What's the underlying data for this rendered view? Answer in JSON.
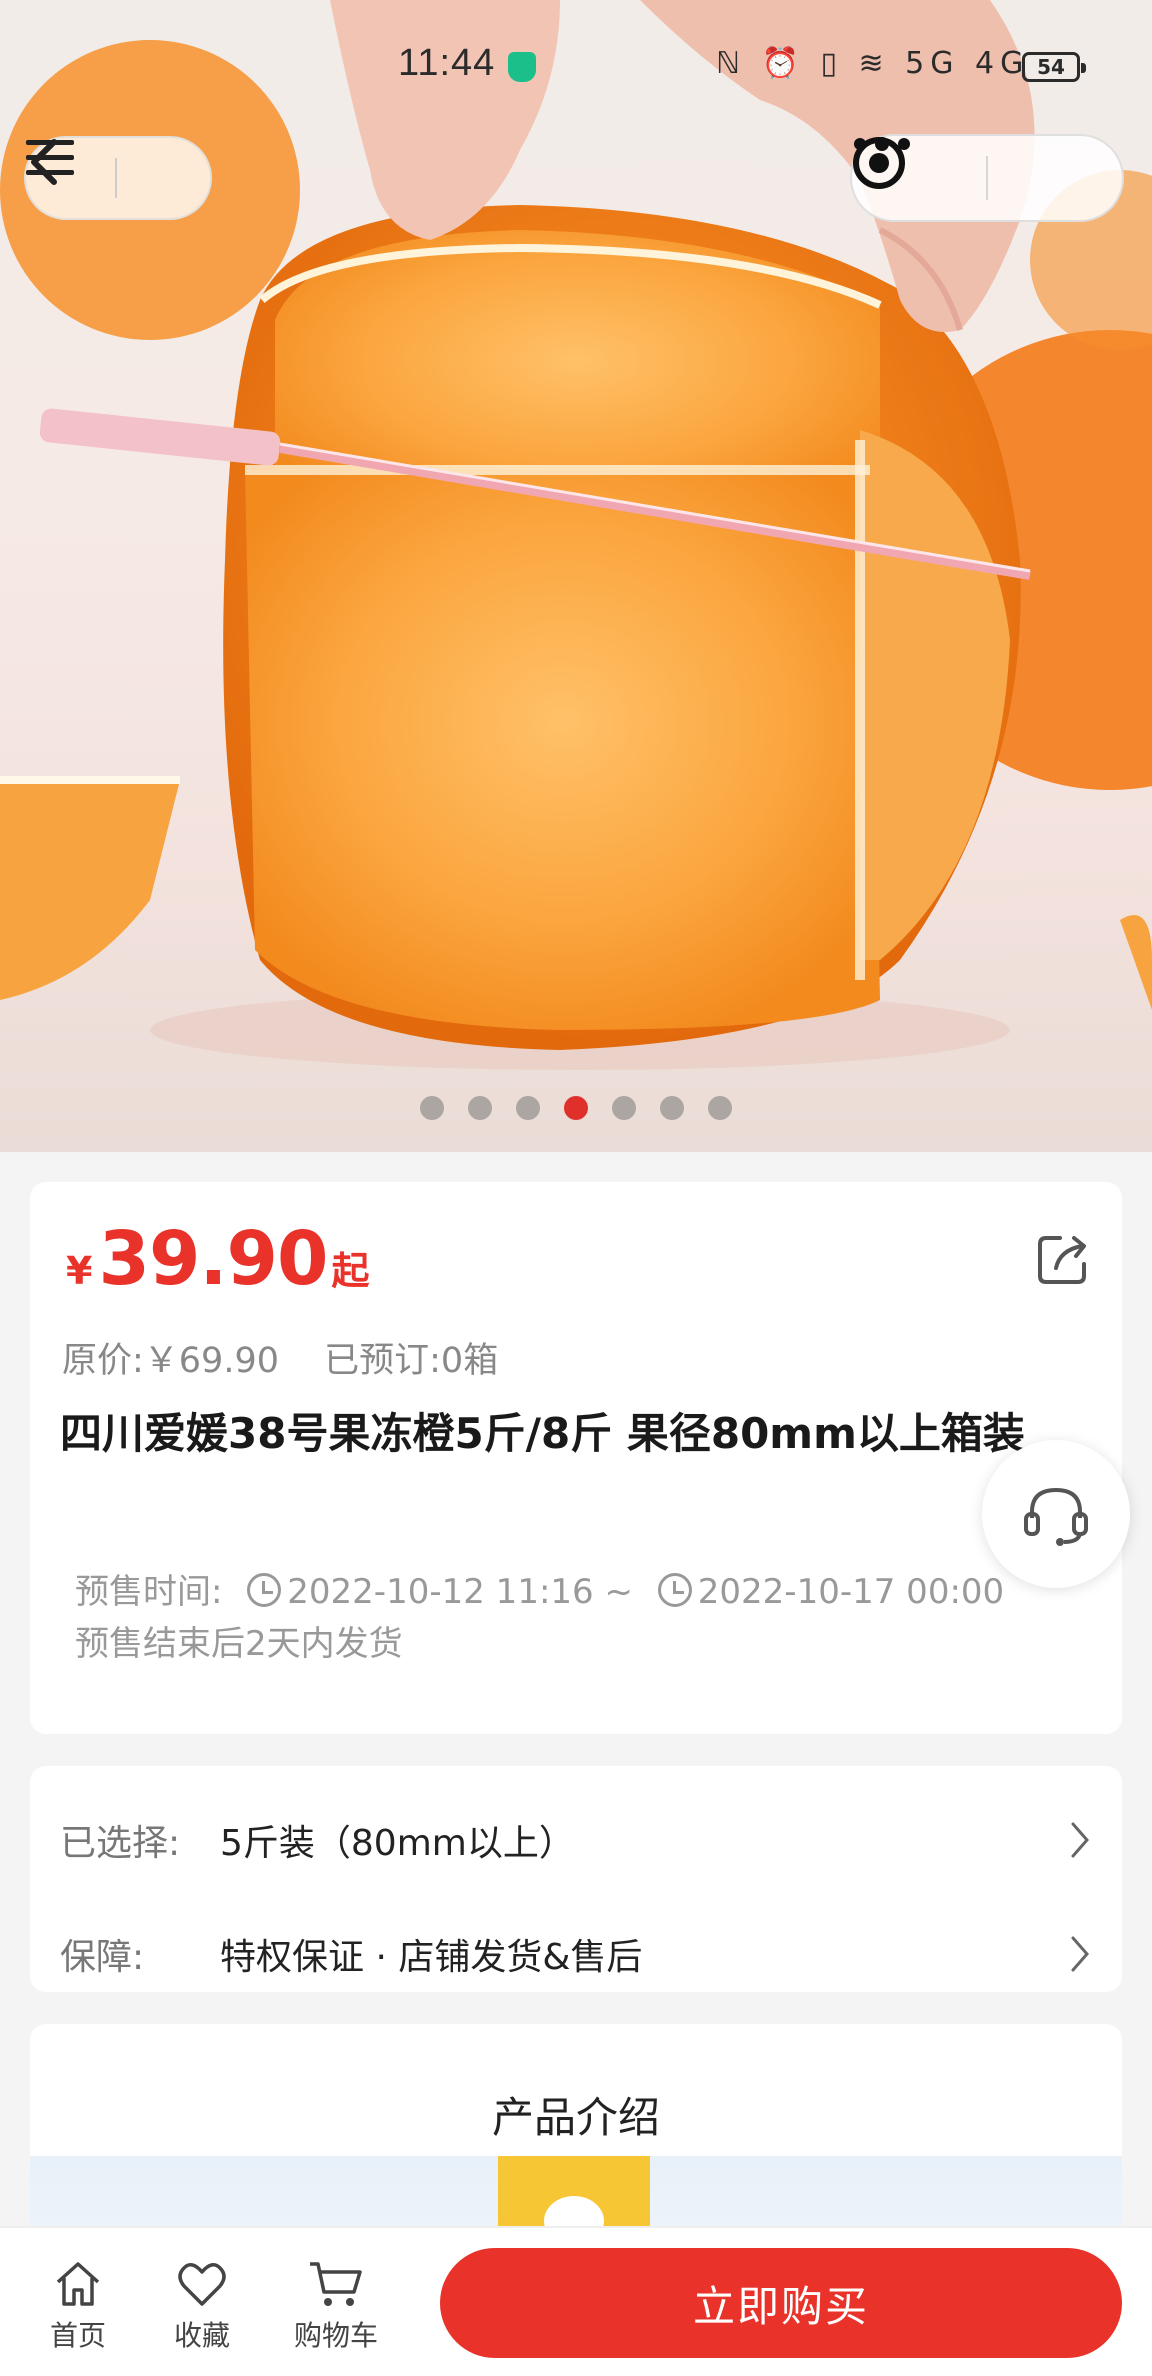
{
  "status_bar": {
    "time": "11:44",
    "net_icons": "ℕ ⏰ ▯ ≋ 5G 4G",
    "battery": "54"
  },
  "navigation": {
    "back_icon": "chevron-left-icon",
    "menu_icon": "hamburger-icon",
    "more_icon": "more-dots-icon",
    "close_icon": "target-close-icon"
  },
  "carousel": {
    "image_alt": "",
    "dot_count": 7,
    "active_index": 3
  },
  "product": {
    "price_symbol": "¥",
    "price": "39.90",
    "price_suffix": "起",
    "original_price": "原价:￥69.90",
    "preordered": "已预订:0箱",
    "title": "四川爱媛38号果冻橙5斤/8斤 果径80mm以上箱装",
    "presale_label": "预售时间:",
    "presale_start": "2022-10-12 11:16 ~",
    "presale_end": "2022-10-17 00:00",
    "shipping_note": "预售结束后2天内发货"
  },
  "options": {
    "selected_label": "已选择:",
    "selected_value": "5斤装（80mm以上）",
    "guarantee_label": "保障:",
    "guarantee_value": "特权保证 · 店铺发货&售后"
  },
  "intro": {
    "title": "产品介绍"
  },
  "bottom_bar": {
    "home": "首页",
    "favorite": "收藏",
    "cart": "购物车",
    "buy_now": "立即购买"
  },
  "colors": {
    "accent": "#e8322a",
    "active_dot": "#e0302b"
  }
}
